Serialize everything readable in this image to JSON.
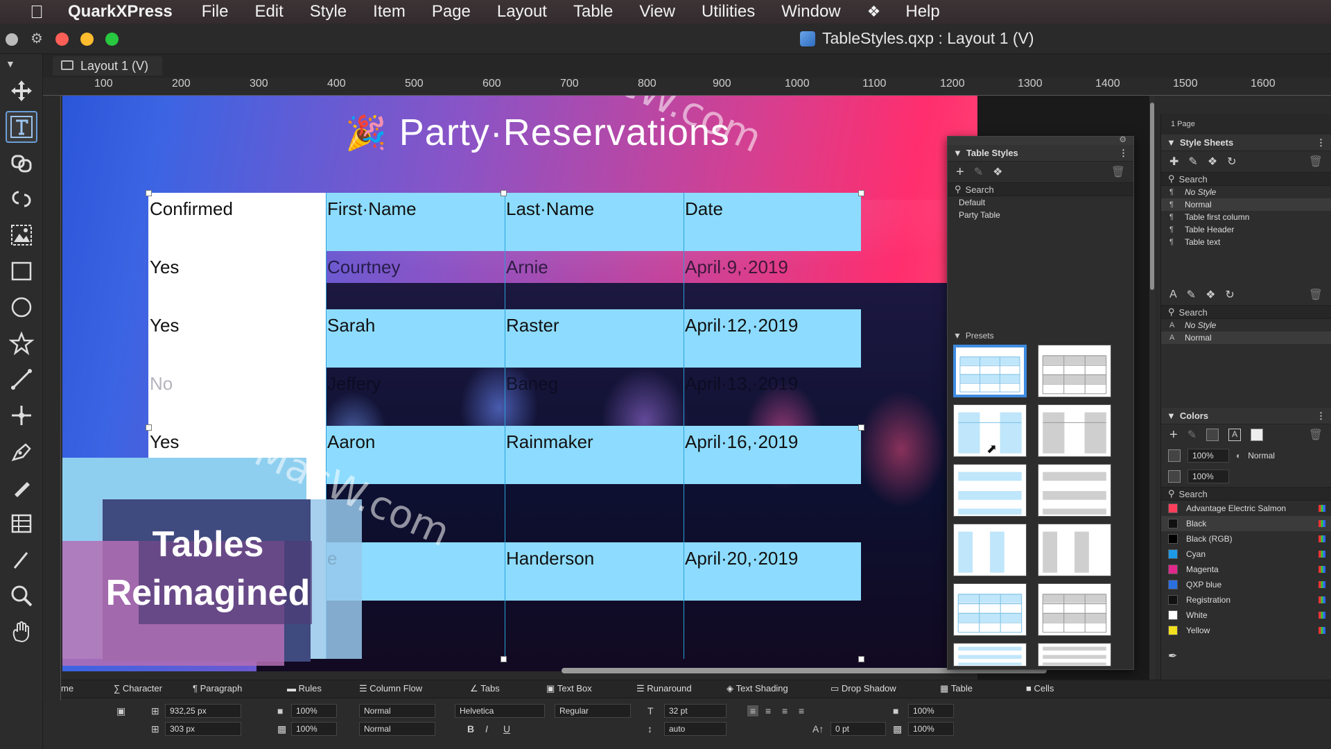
{
  "menubar": {
    "app_name": "QuarkXPress",
    "items": [
      "File",
      "Edit",
      "Style",
      "Item",
      "Page",
      "Layout",
      "Table",
      "View",
      "Utilities",
      "Window",
      "Help"
    ]
  },
  "window": {
    "title": "TableStyles.qxp : Layout 1 (V)",
    "tab": "Layout 1 (V)"
  },
  "ruler": {
    "labels": [
      "100",
      "200",
      "300",
      "400",
      "500",
      "600",
      "700",
      "800",
      "900",
      "1000",
      "1100",
      "1200",
      "1300",
      "1400",
      "1500",
      "1600"
    ]
  },
  "document": {
    "title": "Party·Reservations",
    "promo_line1": "Tables",
    "promo_line2": "Reimagined",
    "table": {
      "headers": [
        "Confirmed",
        "First·Name",
        "Last·Name",
        "Date"
      ],
      "rows": [
        [
          "Yes",
          "Courtney",
          "Arnie",
          "April·9,·2019"
        ],
        [
          "Yes",
          "Sarah",
          "Raster",
          "April·12,·2019"
        ],
        [
          "No",
          "Jeffery",
          "Baneg",
          "April·13,·2019"
        ],
        [
          "Yes",
          "Aaron",
          "Rainmaker",
          "April·16,·2019"
        ],
        [
          "",
          "",
          "",
          ""
        ],
        [
          "",
          "e",
          "Handerson",
          "April·20,·2019"
        ],
        [
          "",
          "",
          "",
          ""
        ]
      ]
    },
    "watermark": "MacW.com"
  },
  "table_styles_panel": {
    "title": "Table Styles",
    "search": "Search",
    "items": [
      "Default",
      "Party Table"
    ],
    "presets_label": "Presets"
  },
  "dock": {
    "pages_label": "1 Page",
    "style_sheets": {
      "title": "Style Sheets",
      "search": "Search",
      "paragraph": [
        "No Style",
        "Normal",
        "Table first column",
        "Table Header",
        "Table text"
      ],
      "character_search": "Search",
      "character": [
        "No Style",
        "Normal"
      ]
    },
    "colors": {
      "title": "Colors",
      "opacity1": "100%",
      "blend": "Normal",
      "opacity2": "100%",
      "search": "Search",
      "items": [
        {
          "name": "Advantage Electric Salmon",
          "hex": "#ff3e5c"
        },
        {
          "name": "Black",
          "hex": "#111111"
        },
        {
          "name": "Black (RGB)",
          "hex": "#000000"
        },
        {
          "name": "Cyan",
          "hex": "#1e9be8"
        },
        {
          "name": "Magenta",
          "hex": "#e0288c"
        },
        {
          "name": "QXP blue",
          "hex": "#2a6fe0"
        },
        {
          "name": "Registration",
          "hex": "#111111"
        },
        {
          "name": "White",
          "hex": "#ffffff"
        },
        {
          "name": "Yellow",
          "hex": "#f2e01e"
        }
      ]
    }
  },
  "measurements": {
    "tabs": [
      "me",
      "Character",
      "Paragraph",
      "Rules",
      "Column Flow",
      "Tabs",
      "Text Box",
      "Runaround",
      "Text Shading",
      "Drop Shadow",
      "Table",
      "Cells"
    ],
    "width": "932,25 px",
    "height": "303 px",
    "opacity_a": "100%",
    "opacity_b": "100%",
    "blend_a": "Normal",
    "blend_b": "Normal",
    "font": "Helvetica",
    "font_style": "Regular",
    "font_size": "32 pt",
    "leading": "auto",
    "baseline": "0 pt",
    "shade_a": "100%",
    "shade_b": "100%",
    "format_buttons": [
      "B",
      "I",
      "U"
    ]
  }
}
